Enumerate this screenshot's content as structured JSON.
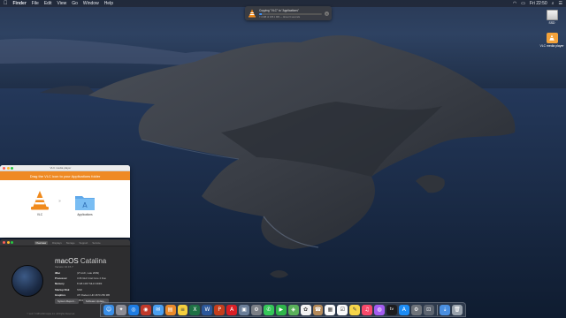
{
  "menubar": {
    "apple_icon": "apple-icon",
    "app_name": "Finder",
    "menus": [
      "File",
      "Edit",
      "View",
      "Go",
      "Window",
      "Help"
    ],
    "clock": "Fri 22:50"
  },
  "copy_progress": {
    "title": "Copying \"VLC\" to \"Applications\"",
    "detail": "7.4 MB of 185.1 MB — About 6 seconds",
    "progress": 0.04
  },
  "desktop_icons": [
    {
      "label": "SSD",
      "icon": "hard-disk-icon"
    },
    {
      "label": "VLC media player",
      "icon": "vlc-icon"
    }
  ],
  "vlc_installer": {
    "window_title": "VLC media player",
    "banner": "Drag the VLC icon to your Applications folder",
    "vlc_label": "VLC",
    "applications_label": "Applications",
    "accent": "#ef8a24"
  },
  "about_mac": {
    "tabs": [
      "Overview",
      "Displays",
      "Storage",
      "Support",
      "Service"
    ],
    "active_tab": 0,
    "os_name": "macOS",
    "os_codename": "Catalina",
    "os_version": "Version 10.15.7",
    "specs": [
      {
        "key": "iMac",
        "value": "(27-inch, Late 2009)"
      },
      {
        "key": "Processor",
        "value": "3.06 GHz Intel Core 2 Duo"
      },
      {
        "key": "Memory",
        "value": "8 GB 1067 MHz DDR3"
      },
      {
        "key": "Startup Disk",
        "value": "SSD"
      },
      {
        "key": "Graphics",
        "value": "ATI Radeon HD 4670 256 MB"
      },
      {
        "key": "Serial Number",
        "value": "W80130DU5PE"
      }
    ],
    "buttons": [
      "System Report...",
      "Software Update..."
    ],
    "copyright": "™ and © 1983-2020 Apple Inc. All Rights Reserved."
  },
  "dock": {
    "apps": [
      {
        "name": "finder",
        "icon": "finder-icon",
        "glyph": "☺",
        "color": "#3a8ee6"
      },
      {
        "name": "launchpad",
        "icon": "launchpad-icon",
        "glyph": "✦",
        "color": "#8c8c94"
      },
      {
        "name": "safari",
        "icon": "safari-icon",
        "glyph": "◎",
        "color": "#1d7ce3"
      },
      {
        "name": "photo-booth",
        "icon": "photo-booth-icon",
        "glyph": "◉",
        "color": "#c0392b"
      },
      {
        "name": "mail",
        "icon": "mail-icon",
        "glyph": "✉",
        "color": "#4a9ff0"
      },
      {
        "name": "books",
        "icon": "books-icon",
        "glyph": "▤",
        "color": "#e98a2b"
      },
      {
        "name": "notes",
        "icon": "notes-icon",
        "glyph": "≡",
        "color": "#f4cf3e"
      },
      {
        "name": "excel",
        "icon": "excel-icon",
        "glyph": "X",
        "color": "#1e7145"
      },
      {
        "name": "word",
        "icon": "word-icon",
        "glyph": "W",
        "color": "#2b579a"
      },
      {
        "name": "powerpoint",
        "icon": "powerpoint-icon",
        "glyph": "P",
        "color": "#c43e1c"
      },
      {
        "name": "acrobat",
        "icon": "acrobat-icon",
        "glyph": "A",
        "color": "#d81f26"
      },
      {
        "name": "preview",
        "icon": "preview-icon",
        "glyph": "▣",
        "color": "#6b7f99"
      },
      {
        "name": "system-preferences",
        "icon": "gear-icon",
        "glyph": "⚙",
        "color": "#7b7f86"
      },
      {
        "name": "messages",
        "icon": "messages-icon",
        "glyph": "✆",
        "color": "#35c759"
      },
      {
        "name": "facetime",
        "icon": "facetime-icon",
        "glyph": "▶",
        "color": "#2fb54a"
      },
      {
        "name": "maps",
        "icon": "maps-icon",
        "glyph": "◈",
        "color": "#5ab05a"
      },
      {
        "name": "photos",
        "icon": "photos-icon",
        "glyph": "✿",
        "color": "#f2f2f2"
      },
      {
        "name": "contacts",
        "icon": "contacts-icon",
        "glyph": "☎",
        "color": "#b48a5a"
      },
      {
        "name": "calendar",
        "icon": "calendar-icon",
        "glyph": "▦",
        "color": "#fafafa"
      },
      {
        "name": "reminders",
        "icon": "reminders-icon",
        "glyph": "☑",
        "color": "#fafafa"
      },
      {
        "name": "notes2",
        "icon": "stickies-icon",
        "glyph": "✎",
        "color": "#f6d54a"
      },
      {
        "name": "music",
        "icon": "music-icon",
        "glyph": "♫",
        "color": "#f84a6b"
      },
      {
        "name": "podcasts",
        "icon": "podcasts-icon",
        "glyph": "◍",
        "color": "#a35cf0"
      },
      {
        "name": "tv",
        "icon": "tv-icon",
        "glyph": "tv",
        "color": "#1c1c1e"
      },
      {
        "name": "app-store",
        "icon": "app-store-icon",
        "glyph": "A",
        "color": "#1c8cf5"
      },
      {
        "name": "system-prefs2",
        "icon": "settings-icon",
        "glyph": "⚙",
        "color": "#6e737a"
      },
      {
        "name": "screenshot",
        "icon": "screenshot-icon",
        "glyph": "⊡",
        "color": "#5c6470"
      }
    ],
    "trailing": [
      {
        "name": "downloads",
        "icon": "downloads-icon",
        "glyph": "⇣",
        "color": "#4a8fe0"
      },
      {
        "name": "trash",
        "icon": "trash-icon",
        "glyph": "🗑",
        "color": "#9aa3ad"
      }
    ]
  }
}
